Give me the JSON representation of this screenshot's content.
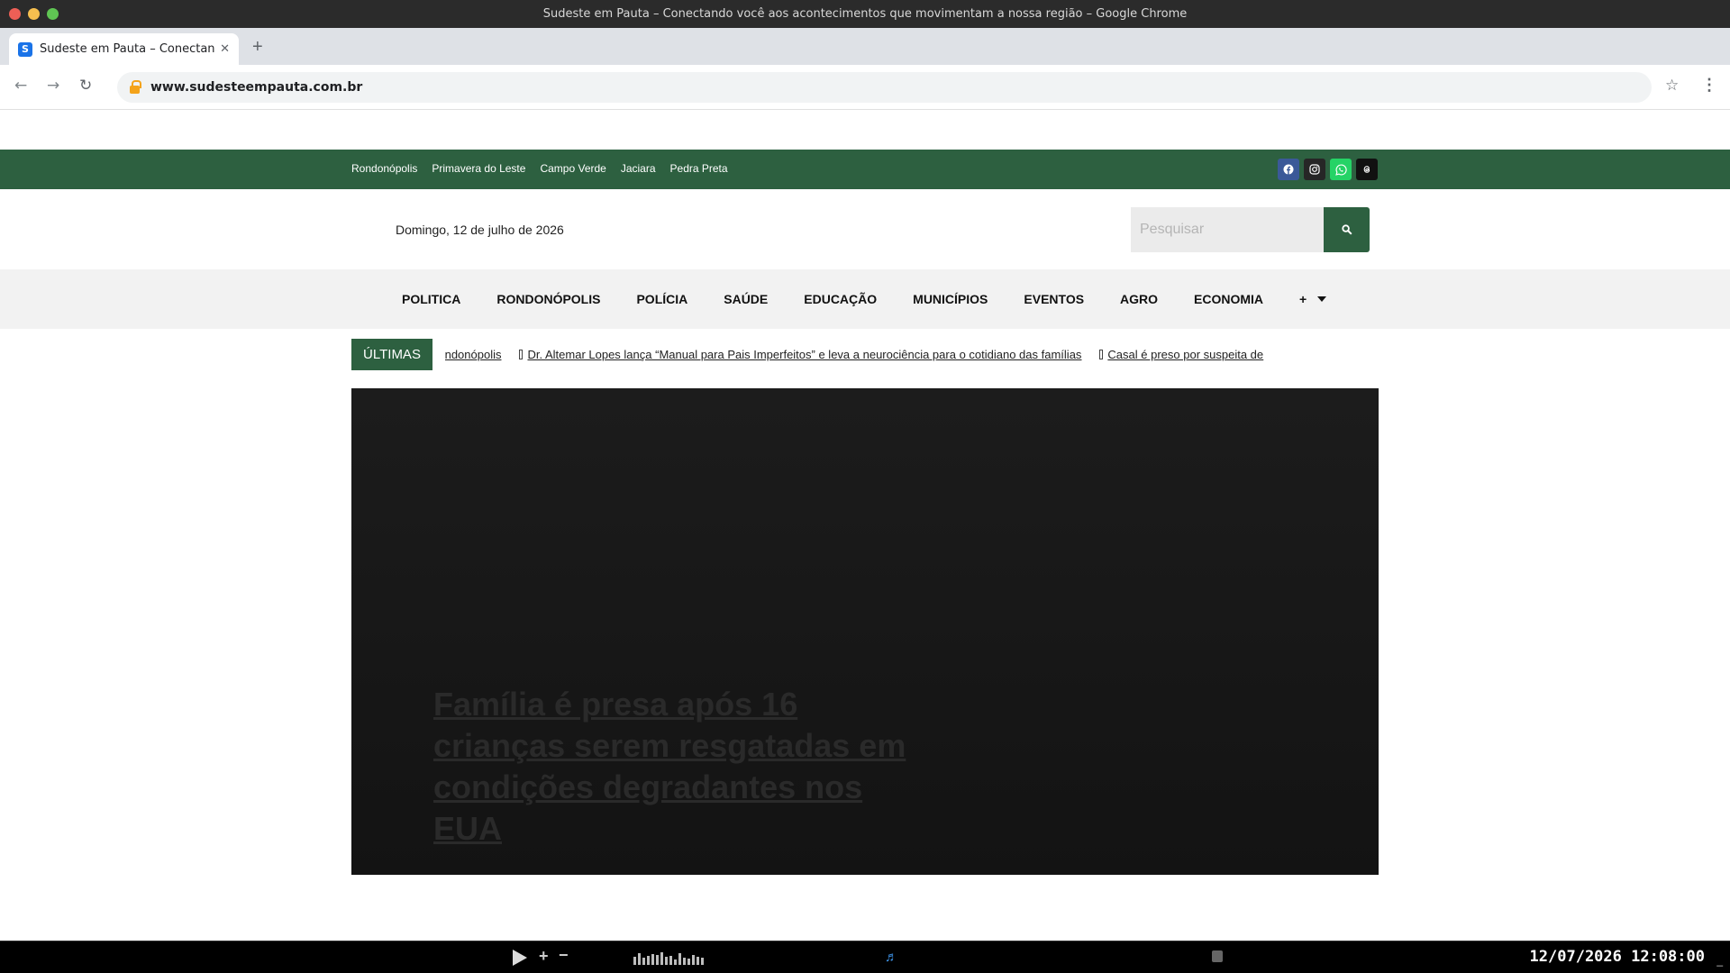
{
  "window": {
    "title": "Sudeste em Pauta – Conectando você aos acontecimentos que movimentam a nossa região – Google Chrome"
  },
  "browser": {
    "tab_title": "Sudeste em Pauta – Conectando ...",
    "favicon_letter": "S",
    "url": "www.sudesteempauta.com.br"
  },
  "topbar": {
    "cities": [
      "Rondonópolis",
      "Primavera do Leste",
      "Campo Verde",
      "Jaciara",
      "Pedra Preta"
    ],
    "social_icons": [
      "facebook-icon",
      "instagram-icon",
      "whatsapp-icon",
      "threads-icon"
    ]
  },
  "header": {
    "date": "Domingo, 12 de julho de 2026",
    "search_placeholder": "Pesquisar"
  },
  "nav": {
    "items": [
      "POLITICA",
      "RONDONÓPOLIS",
      "POLÍCIA",
      "SAÚDE",
      "EDUCAÇÃO",
      "MUNICÍPIOS",
      "EVENTOS",
      "AGRO",
      "ECONOMIA"
    ],
    "more_label": "+"
  },
  "ticker": {
    "label": "ÚLTIMAS",
    "items": [
      "ado em Rondonópolis",
      "Dr. Altemar Lopes lança “Manual para Pais Imperfeitos” e leva a neurociência para o cotidiano das famílias",
      "Casal é preso por suspeita de"
    ]
  },
  "hero": {
    "title": "Família é presa após 16 crianças serem resgatadas em condições degradantes nos EUA"
  },
  "taskbar": {
    "clock": "12/07/2026 12:08:00",
    "edge_label": "_",
    "plus_label": "+",
    "minus_label": "−"
  }
}
